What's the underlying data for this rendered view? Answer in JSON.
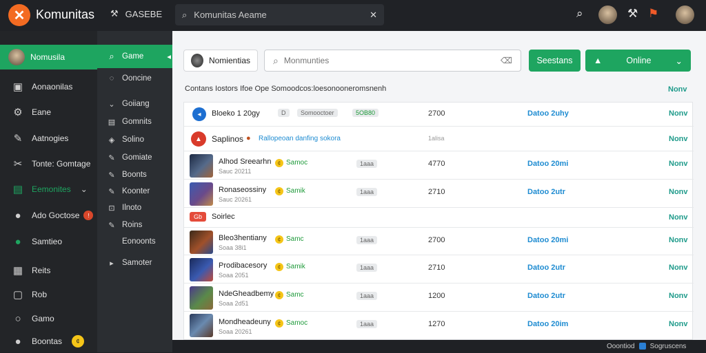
{
  "topbar": {
    "brand": "Komunitas",
    "nav_label": "GASEBE",
    "search_placeholder": "Komunitas Aeame",
    "close_glyph": "✕"
  },
  "leftnav": {
    "profile": "Nomusila",
    "items": [
      {
        "label": "Aonaonilas",
        "icon": "folder-icon"
      },
      {
        "label": "Eane",
        "icon": "gear-icon"
      },
      {
        "label": "Aatnogies",
        "icon": "pin-icon"
      },
      {
        "label": "Tonte: Gomtage",
        "icon": "wrench-icon"
      },
      {
        "label": "Eemonites",
        "icon": "chat-icon"
      },
      {
        "label": "Ado Goctose",
        "icon": "user-icon"
      },
      {
        "label": "Samtieo",
        "icon": "globe-icon"
      },
      {
        "label": "Reits",
        "icon": "grid-icon"
      },
      {
        "label": "Rob",
        "icon": "box-icon"
      },
      {
        "label": "Gamo",
        "icon": "circle-icon"
      },
      {
        "label": "Boontas",
        "icon": "user-icon"
      }
    ]
  },
  "subnav": {
    "items": [
      {
        "label": "Game",
        "icon": "search-icon"
      },
      {
        "label": "Ooncine",
        "icon": "chat-icon"
      },
      {
        "label": "Goiiang",
        "icon": "chevron-icon"
      },
      {
        "label": "Gomnits",
        "icon": "doc-icon"
      },
      {
        "label": "Solino",
        "icon": "shield-icon"
      },
      {
        "label": "Gomiate",
        "icon": "pencil-icon"
      },
      {
        "label": "Boonts",
        "icon": "pencil-icon"
      },
      {
        "label": "Koonter",
        "icon": "pencil-icon"
      },
      {
        "label": "Ilnoto",
        "icon": "lock-icon"
      },
      {
        "label": "Roins",
        "icon": "pencil-icon"
      },
      {
        "label": "Eonoonts",
        "icon": ""
      },
      {
        "label": "Samoter",
        "icon": "triangle-icon"
      }
    ]
  },
  "main": {
    "profile_btn": "Nomientias",
    "search_placeholder": "Monmunties",
    "btn_sessions": "Seestans",
    "btn_online": "Online",
    "caption": "Contans Iostors Ifoe Ope Somoodcos:loesonooneromsnenh",
    "header_link": "Nonv"
  },
  "rows": [
    {
      "kind": "header",
      "icon": "blue",
      "title": "Bloeko 1 20gy",
      "pill": "D",
      "pill2": "Somooctoer",
      "tag": "5OB80",
      "num": "2700",
      "date": "Datoo 2uhy",
      "more": "Nonv"
    },
    {
      "kind": "section",
      "icon": "red",
      "title": "Saplinos",
      "link": "Rallopeoan danfing sokora",
      "num": "1alisa",
      "more": "Nonv"
    },
    {
      "kind": "item",
      "title": "Alhod Sreearhn",
      "sub": "Sauc 20211",
      "tag": "Samoc",
      "pill": "1aaa",
      "num": "4770",
      "date": "Datoo 20mi",
      "more": "Nonv"
    },
    {
      "kind": "item",
      "title": "Ronaseossiny",
      "sub": "Sauc 20261",
      "tag": "Samik",
      "pill": "1aaa",
      "num": "2710",
      "date": "Datoo 2utr",
      "more": "Nonv"
    },
    {
      "kind": "label",
      "badge": "Gb",
      "title": "Soirlec",
      "more": "Nonv"
    },
    {
      "kind": "item",
      "title": "Bleo3hentiany",
      "sub": "Soaa 38i1",
      "tag": "Samc",
      "pill": "1aaa",
      "num": "2700",
      "date": "Datoo 20mi",
      "more": "Nonv"
    },
    {
      "kind": "item",
      "title": "Prodibacesory",
      "sub": "Soaa 2051",
      "tag": "Samik",
      "pill": "1aaa",
      "num": "2710",
      "date": "Datoo 2utr",
      "more": "Nonv"
    },
    {
      "kind": "item",
      "title": "NdeGheadbemy",
      "sub": "Soaa 2d51",
      "tag": "Samc",
      "pill": "1aaa",
      "num": "1200",
      "date": "Datoo 2utr",
      "more": "Nonv"
    },
    {
      "kind": "item",
      "title": "Mondheadeuny",
      "sub": "Soaa 20261",
      "tag": "Samoc",
      "pill": "1aaa",
      "num": "1270",
      "date": "Datoo 20im",
      "more": "Nonv"
    }
  ],
  "statusbar": {
    "left": "Ooontiod",
    "right": "Sogruscens"
  },
  "colors": {
    "accent": "#1ea560",
    "date": "#1d8bd1",
    "link": "#1e9a8a"
  }
}
